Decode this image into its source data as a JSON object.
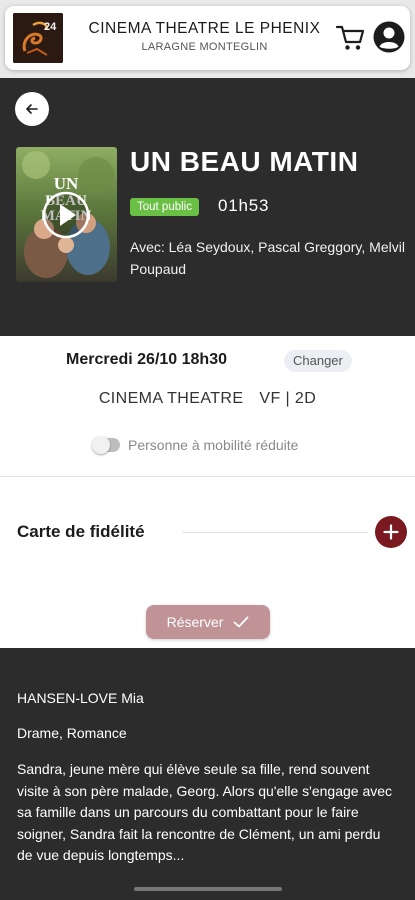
{
  "header": {
    "title": "CINEMA THEATRE LE PHENIX",
    "subtitle": "LARAGNE MONTEGLIN",
    "logo_icon": "cinema-logo",
    "cart_icon": "cart-icon",
    "account_icon": "account-icon"
  },
  "movie": {
    "title": "UN BEAU MATIN",
    "rating_badge": "Tout public",
    "duration": "01h53",
    "cast": "Avec: Léa Seydoux, Pascal Greggory, Melvil Poupaud",
    "poster_text": "UN BEAU MATIN"
  },
  "session": {
    "date_time": "Mercredi 26/10 18h30",
    "change_label": "Changer",
    "venue": "CINEMA THEATRE",
    "format": "VF | 2D",
    "pmr_label": "Personne à mobilité réduite",
    "pmr_enabled": false
  },
  "loyalty": {
    "label": "Carte de fidélité"
  },
  "reserve": {
    "label": "Réserver"
  },
  "info": {
    "director": "HANSEN-LOVE Mia",
    "genres": "Drame, Romance",
    "synopsis": "Sandra, jeune mère qui élève seule sa fille, rend souvent visite à son père malade, Georg. Alors qu'elle s'engage avec sa famille dans un parcours du combattant pour le faire soigner, Sandra fait la rencontre de Clément, un ami perdu de vue depuis longtemps..."
  },
  "colors": {
    "dark_bg": "#2c2c2c",
    "badge_green": "#6ac045",
    "accent_red": "#7a1a20",
    "reserve_disabled": "#c09397"
  }
}
